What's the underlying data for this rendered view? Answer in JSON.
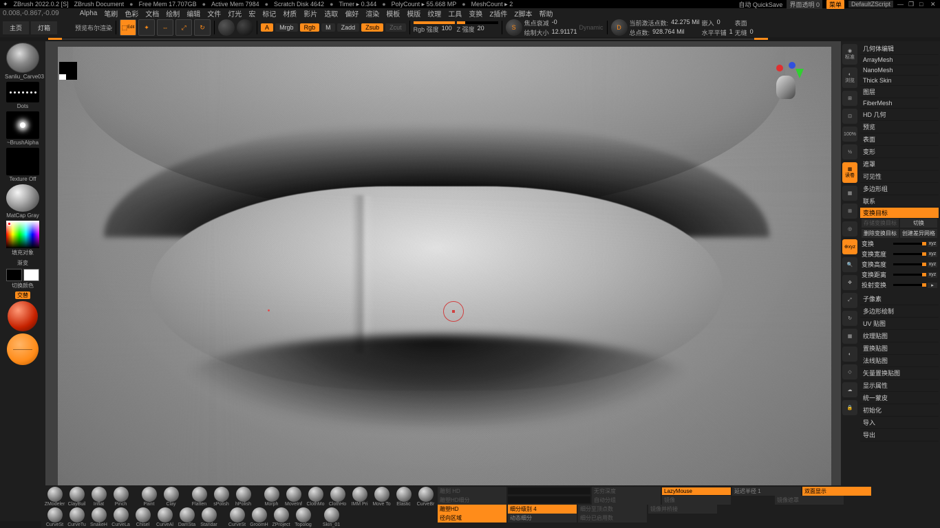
{
  "title_bar": {
    "app": "ZBrush 2022.0.2 [S]",
    "document": "ZBrush Document",
    "free_mem": "Free Mem 17.707GB",
    "active_mem": "Active Mem 7984",
    "scratch": "Scratch Disk 4642",
    "timer": "Timer ▸ 0.344",
    "polycount": "PolyCount ▸ 55.668 MP",
    "meshcount": "MeshCount ▸ 2",
    "autosave": "自动 QuickSave",
    "transparency": "界面透明 0",
    "menu": "菜单",
    "default_script": "DefaultZScript"
  },
  "coords": "0.008,-0.867,-0.09",
  "menus": [
    "Alpha",
    "笔刷",
    "色彩",
    "文档",
    "绘制",
    "编辑",
    "文件",
    "灯光",
    "宏",
    "标记",
    "材质",
    "影片",
    "选取",
    "偏好",
    "渲染",
    "模板",
    "模版",
    "纹理",
    "工具",
    "变换",
    "Z插件",
    "Z脚本",
    "帮助"
  ],
  "tabs": {
    "home": "主页",
    "lightbox": "灯箱",
    "preview": "预览布尔渲染"
  },
  "optbar": {
    "mode_a": "A",
    "mrgb": "Mrgb",
    "rgb": "Rgb",
    "m": "M",
    "zadd": "Zadd",
    "zsub": "Zsub",
    "zcut": "Zcut",
    "rgb_intensity_label": "Rgb 强度",
    "rgb_intensity": "100",
    "z_intensity_label": "Z 强度",
    "z_intensity": "20",
    "focal_label": "焦点衰减",
    "focal": "-0",
    "draw_size_label": "绘制大小",
    "draw_size": "12.91171",
    "dynamic": "Dynamic",
    "active_points_label": "当前激活点数:",
    "active_points": "42.275 Mil",
    "total_points_label": "总点数:",
    "total_points": "928.764 Mil",
    "embed_label": "嵌入",
    "embed": "0",
    "hflip_label": "水平平铺",
    "hflip": "1",
    "surface": "表面",
    "seam_label": "无缝",
    "seam": "0"
  },
  "left": {
    "brush": "Sanliu_Carve03",
    "stroke": "Dots",
    "alpha": "~BrushAlpha",
    "texture": "Texture Off",
    "material": "MatCap Gray",
    "fill_obj": "填充对象",
    "gradient": "渐变",
    "switch_color": "切换颜色",
    "alternate": "交替"
  },
  "right_icons": [
    "标准",
    "浏览",
    "Scale3D",
    "缩放",
    "100%",
    "Actors",
    "读卷",
    "线框渲染",
    "XYZ",
    "🔍",
    "✥",
    "锁",
    "视图",
    "Line Fill",
    "透视",
    "灯",
    "☁",
    "🔒"
  ],
  "right_panel": {
    "items_top": [
      "几何体编辑",
      "ArrayMesh",
      "NanoMesh",
      "Thick Skin",
      "图层",
      "FiberMesh",
      "HD 几何",
      "预览",
      "表面",
      "变形",
      "遮罩",
      "可见性",
      "多边形组",
      "联系"
    ],
    "morph_header": "变换目标",
    "store": "存储变换目标",
    "switch": "切换",
    "del_morph": "删除变换目标",
    "create_diff": "创建差异网格",
    "sliders": [
      {
        "label": "变换"
      },
      {
        "label": "变换宽度"
      },
      {
        "label": "变换高度"
      },
      {
        "label": "变换距离"
      },
      {
        "label": "投射变换"
      }
    ],
    "items_bottom": [
      "子像素",
      "多边形绘制",
      "UV 贴图",
      "纹理贴图",
      "置换贴图",
      "法线贴图",
      "矢量置换贴图",
      "显示属性",
      "统一蒙皮",
      "初始化",
      "导入",
      "导出"
    ]
  },
  "bottom": {
    "brushes_row1": [
      "ZModeler",
      "ClayBuil",
      "Inflat",
      "Pinch",
      "",
      "Paint",
      "Clay",
      "",
      "Flatten",
      "sPolish",
      "hPolish",
      "",
      "Morph",
      "MoveInf",
      "ClothMo",
      "ClothHo",
      "IMM Pri",
      "Move To",
      "Elastic"
    ],
    "brushes_row2": [
      "CurveBr",
      "CurveSt",
      "CurveTu",
      "SnakeH",
      "CurveLa",
      "Chisel",
      "CurveAl",
      "DamSta",
      "Standar",
      "",
      "CurveSt",
      "GroomH",
      "ZProject",
      "Topolog",
      "",
      "Skin_01"
    ],
    "controls": {
      "sculpt_hd": "雕刻 HD",
      "infinite_depth": "无穷深度",
      "lazymouse": "LazyMouse",
      "lazy_radius_label": "延迟半径",
      "lazy_radius": "1",
      "double_display": "双面显示",
      "sculpt_hd_sub": "雕塑HD细分",
      "auto_subdiv": "自动分组",
      "mirror": "镜像",
      "mirror_cover": "镜像遮罩",
      "sculpt_hd2": "雕塑HD",
      "subdiv_level_label": "细分级别",
      "subdiv_level": "4",
      "sub_by_vert": "细分至顶点数",
      "mirror_bridge": "镜像并桥接",
      "radial_area": "径向区域",
      "dynamic_subdiv": "动态细分",
      "sub_already": "细分已启用数"
    }
  }
}
